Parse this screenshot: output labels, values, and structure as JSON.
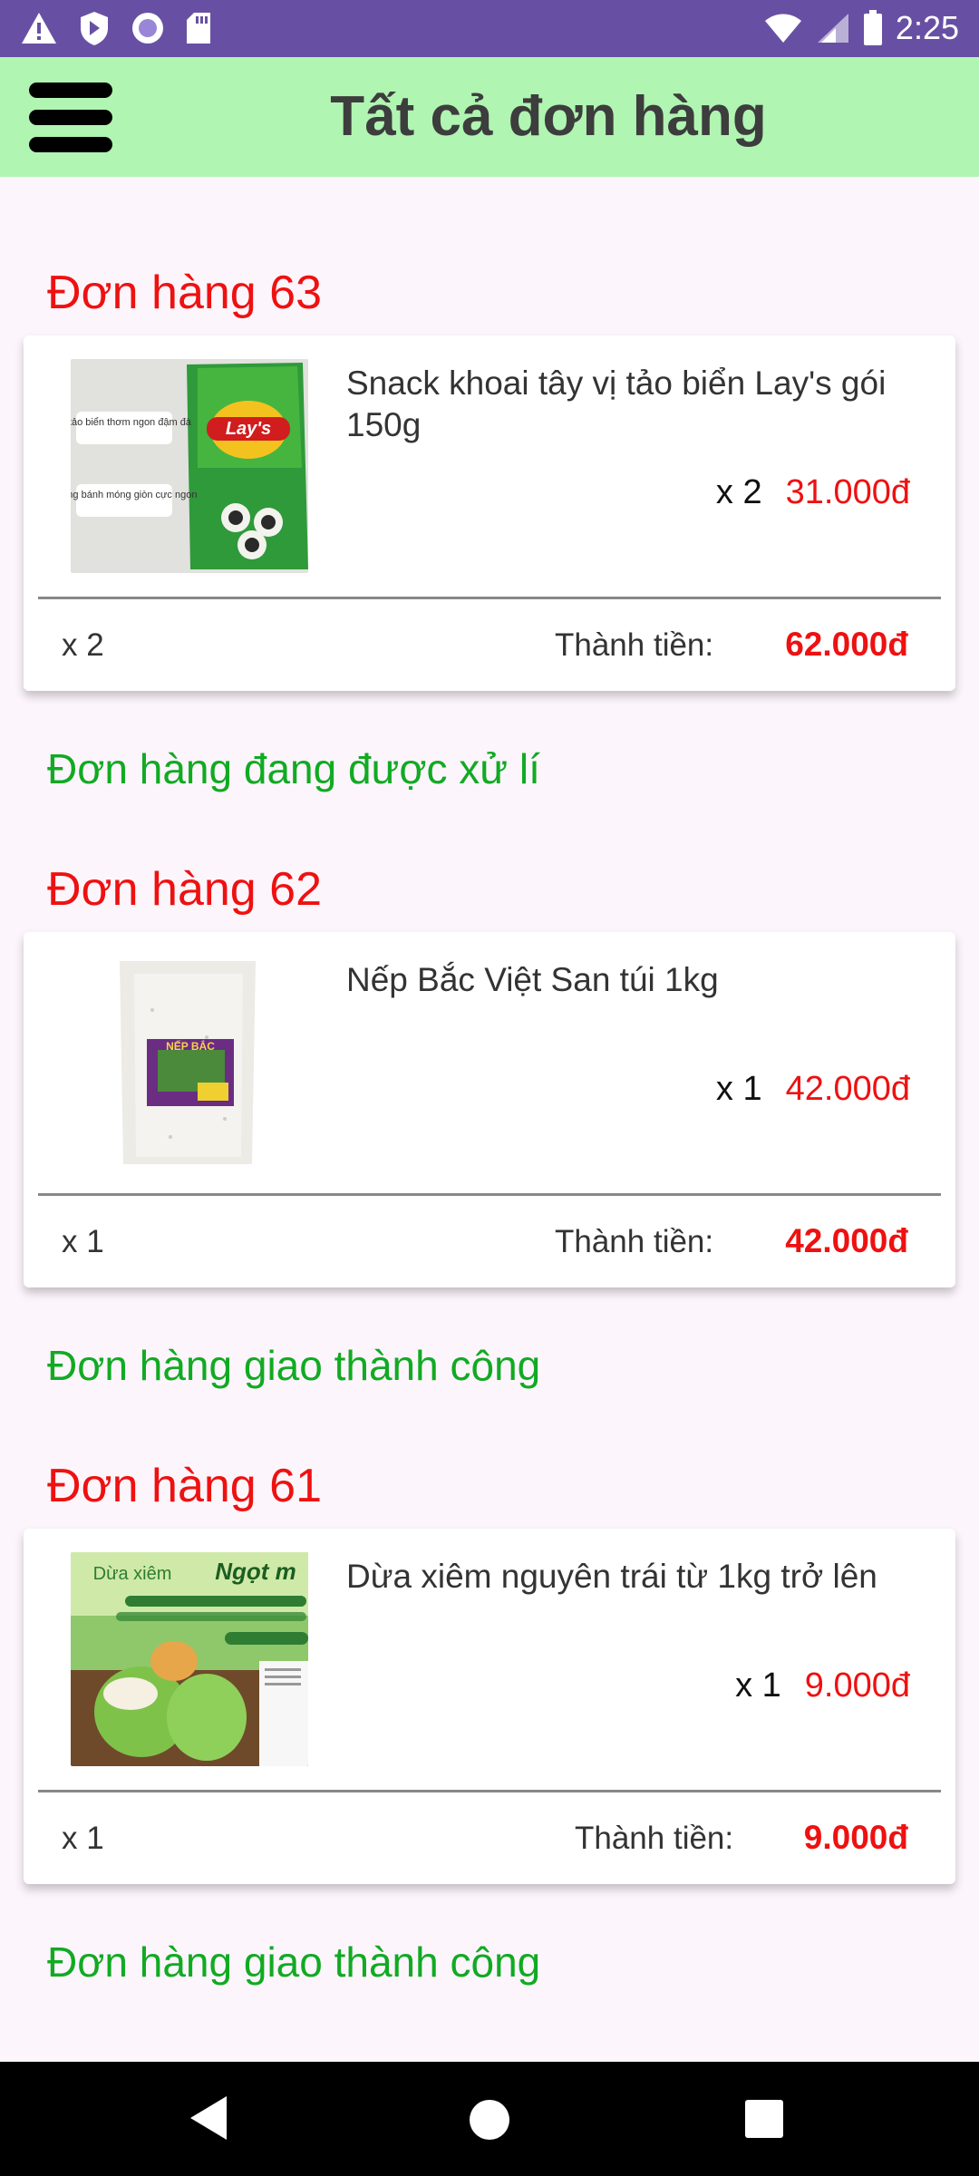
{
  "status_bar": {
    "time": "2:25"
  },
  "app_bar": {
    "title": "Tất cả đơn hàng"
  },
  "orders": [
    {
      "title": "Đơn hàng 63",
      "product_name": "Snack khoai tây vị tảo biển Lay's gói 150g",
      "qty": "x 2",
      "unit_price": "31.000đ",
      "footer_qty": "x 2",
      "total_label": "Thành tiền:",
      "total": "62.000đ",
      "status": "Đơn hàng đang được xử lí",
      "image_text": [
        "Vị tảo biển thơm ngon đậm đà",
        "Miếng bánh móng giòn cực ngon",
        "Lay's"
      ]
    },
    {
      "title": "Đơn hàng 62",
      "product_name": "Nếp Bắc Việt San túi 1kg",
      "qty": "x 1",
      "unit_price": "42.000đ",
      "footer_qty": "x 1",
      "total_label": "Thành tiền:",
      "total": "42.000đ",
      "status": "Đơn hàng giao thành công",
      "image_text": [
        "NẾP BẮC"
      ]
    },
    {
      "title": "Đơn hàng 61",
      "product_name": "Dừa xiêm nguyên trái từ 1kg trở lên",
      "qty": "x 1",
      "unit_price": "9.000đ",
      "footer_qty": "x 1",
      "total_label": "Thành tiền:",
      "total": "9.000đ",
      "status": "Đơn hàng giao thành công",
      "image_text": [
        "Dừa xiêm",
        "Ngọt m"
      ]
    }
  ],
  "colors": {
    "status_bar": "#6750a4",
    "app_bar": "#b0f5b2",
    "price": "#ee1111",
    "status_ok": "#11aa22"
  }
}
